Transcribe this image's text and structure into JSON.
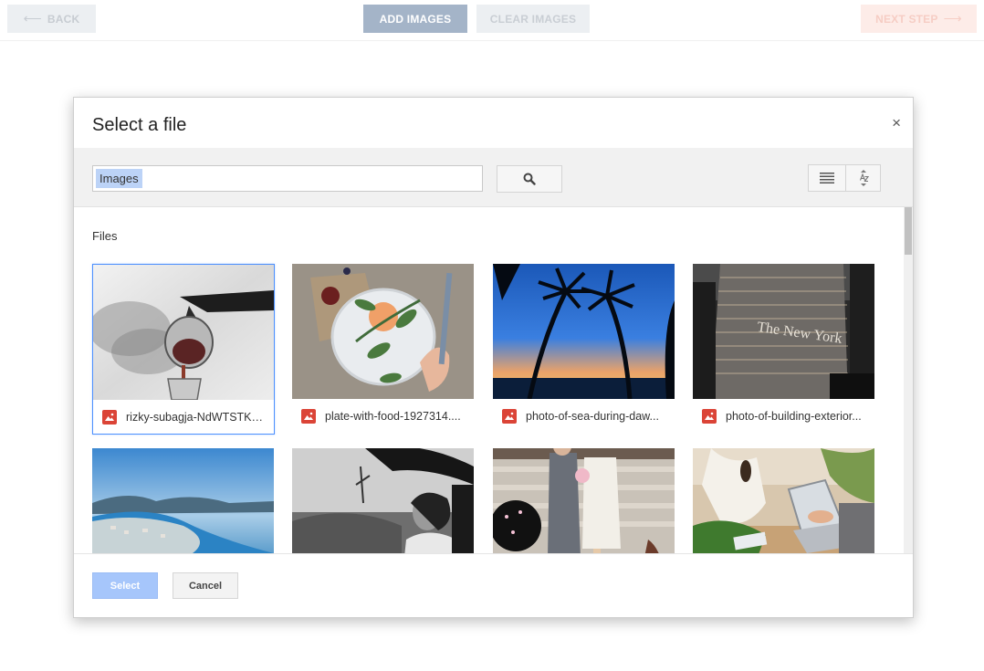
{
  "toolbar": {
    "back_label": "BACK",
    "add_images_label": "ADD IMAGES",
    "clear_images_label": "CLEAR IMAGES",
    "next_step_label": "NEXT STEP"
  },
  "dialog": {
    "title": "Select a file",
    "close_glyph": "×",
    "search": {
      "value": "Images"
    },
    "section_label": "Files",
    "files": [
      {
        "name": "rizky-subagja-NdWTSTK0...",
        "selected": true
      },
      {
        "name": "plate-with-food-1927314....",
        "selected": false
      },
      {
        "name": "photo-of-sea-during-daw...",
        "selected": false
      },
      {
        "name": "photo-of-building-exterior...",
        "selected": false
      },
      {
        "name": "",
        "selected": false
      },
      {
        "name": "",
        "selected": false
      },
      {
        "name": "",
        "selected": false
      },
      {
        "name": "",
        "selected": false
      }
    ],
    "select_label": "Select",
    "cancel_label": "Cancel"
  },
  "colors": {
    "accent": "#4d90fe",
    "primary_disabled": "#a6c6fb",
    "file_icon": "#db4437"
  },
  "icons": [
    "arrow-left-icon",
    "arrow-right-icon",
    "close-icon",
    "search-icon",
    "list-view-icon",
    "sort-az-icon",
    "image-file-icon"
  ]
}
